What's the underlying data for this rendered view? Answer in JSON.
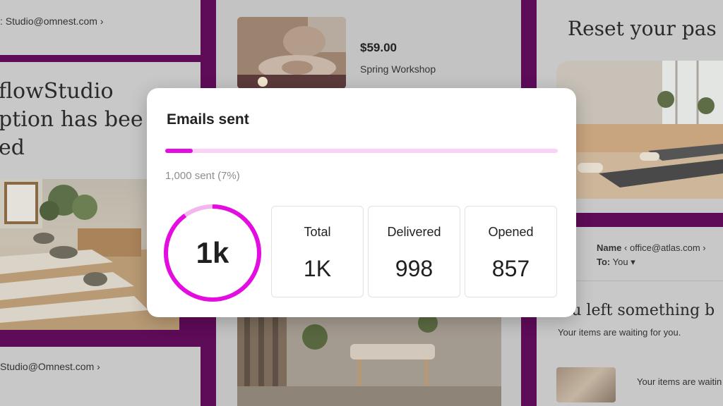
{
  "left_panel": {
    "sender_top": ": Studio@omnest.com ›",
    "headline_lines": [
      "flowStudio",
      "ption has bee",
      "ed"
    ],
    "sender_bottom": "Studio@Omnest.com ›"
  },
  "middle_panel": {
    "price": "$59.00",
    "item_name": "Spring Workshop"
  },
  "right_panel": {
    "reset_title": "Reset your pas",
    "name_label": "Name",
    "name_email": "‹ office@atlas.com ›",
    "to_label": "To:",
    "to_value": "You ▾",
    "left_something_title": "ou left something b",
    "waiting_text": "Your items are waiting for you.",
    "waiting_text_2": "Your items are waitin"
  },
  "stats_card": {
    "title": "Emails sent",
    "progress_fraction": 0.07,
    "progress_caption": "1,000 sent",
    "progress_percent": "(7%)",
    "ring_value": "1k",
    "ring_fraction": 0.9,
    "stats": {
      "total": {
        "label": "Total",
        "value": "1K"
      },
      "delivered": {
        "label": "Delivered",
        "value": "998"
      },
      "opened": {
        "label": "Opened",
        "value": "857"
      }
    }
  },
  "colors": {
    "accent": "#e40ce0",
    "accent_light": "#fad2f6",
    "backdrop": "#5e0b58"
  }
}
